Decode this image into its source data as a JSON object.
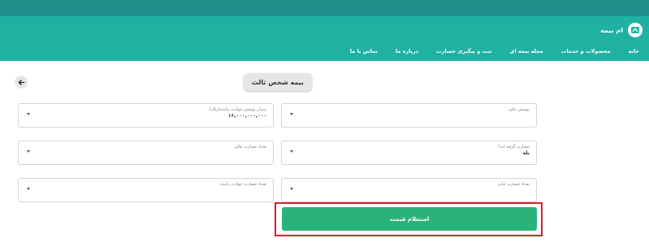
{
  "brand": {
    "name": "ام بیمه",
    "logo_icon": "mbimeh-logo-icon"
  },
  "nav": {
    "items": [
      "خانه",
      "محصولات و خدمات",
      "مجله بیمه ای",
      "ثبت و پیگیری خسارت",
      "درباره ما",
      "تماس با ما"
    ]
  },
  "page": {
    "title": "بیمه شخص ثالث",
    "back_icon": "arrow-left-icon"
  },
  "form": {
    "fields": [
      {
        "label": "پوشش مالی",
        "value": ""
      },
      {
        "label": "میزان پوشش حوادث راننده(ریال)",
        "value": "۱۶,۰۰۰,۰۰۰,۰۰۰"
      },
      {
        "label": "خسارت گرفته اید؟",
        "value": "بله"
      },
      {
        "label": "تعداد خسارت مالی",
        "value": ""
      },
      {
        "label": "تعداد خسارت جانی",
        "value": ""
      },
      {
        "label": "تعداد خسارت حوادث راننده",
        "value": ""
      }
    ],
    "submit_label": "استعلام قیمت"
  },
  "colors": {
    "top_strip": "#1f8f8c",
    "navbar": "#20b1a3",
    "submit": "#29b27a",
    "highlight": "#d32027"
  }
}
